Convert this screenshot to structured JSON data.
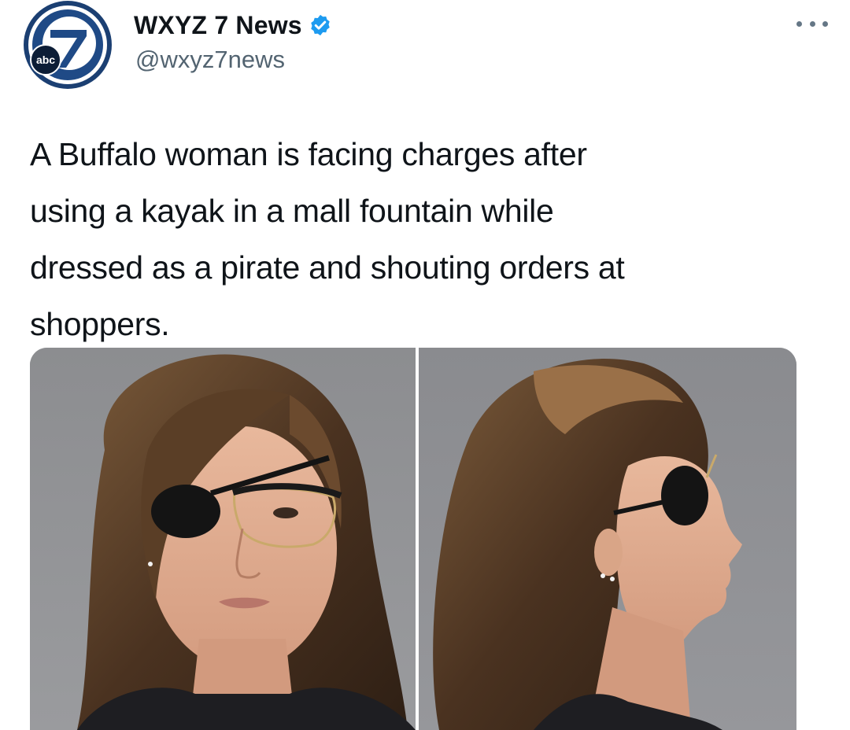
{
  "account": {
    "display_name": "WXYZ 7 News",
    "handle": "@wxyz7news",
    "verified": true,
    "avatar_icon": "abc7-logo-icon",
    "avatar_logo_text": "abc",
    "brand_color": "#1b3f72"
  },
  "menu": {
    "icon": "more-options-icon"
  },
  "tweet": {
    "text": "A Buffalo woman is facing charges after\nusing a kayak in a mall fountain while\ndressed as a pirate and shouting orders at\nshoppers."
  },
  "media": {
    "panels": [
      "front-view-photo",
      "profile-view-photo"
    ],
    "background_color": "#8e9094"
  }
}
